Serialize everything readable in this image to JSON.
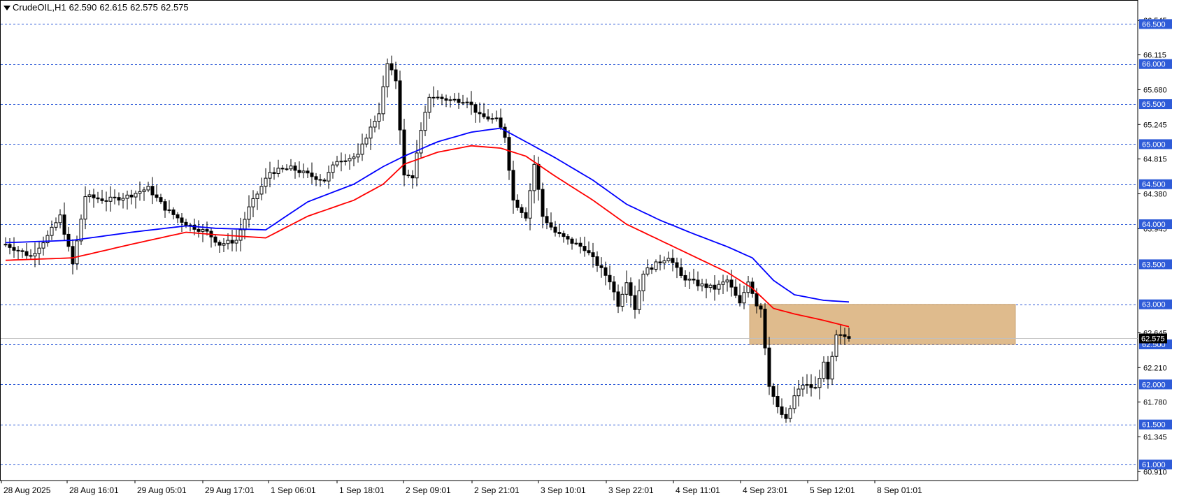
{
  "header": {
    "symbol": "CrudeOIL,H1",
    "open": "62.590",
    "high": "62.615",
    "low": "62.575",
    "close": "62.575"
  },
  "colors": {
    "bull_fill": "#ffffff",
    "bear_fill": "#000000",
    "candle_outline": "#000000",
    "ma_fast": "#ff0000",
    "ma_slow": "#0000ff",
    "level_line": "#2e5bd8",
    "level_label_bg": "#2e5bd8",
    "level_label_text": "#ffffff",
    "zone_fill": "#deb887",
    "price_label_bg": "#000000",
    "price_label_text": "#ffffff"
  },
  "chart_data": {
    "type": "candlestick",
    "timeframe": "H1",
    "ylim": [
      60.8,
      66.8
    ],
    "y_ticks": [
      "66.545",
      "66.115",
      "65.680",
      "65.245",
      "64.815",
      "64.380",
      "63.945",
      "62.645",
      "62.210",
      "61.780",
      "61.345",
      "60.910"
    ],
    "x_labels": [
      "28 Aug 2025",
      "28 Aug 16:01",
      "29 Aug 05:01",
      "29 Aug 17:01",
      "1 Sep 06:01",
      "1 Sep 18:01",
      "2 Sep 09:01",
      "2 Sep 21:01",
      "3 Sep 10:01",
      "3 Sep 22:01",
      "4 Sep 11:01",
      "4 Sep 23:01",
      "5 Sep 12:01",
      "8 Sep 01:01"
    ],
    "levels": [
      "66.500",
      "66.000",
      "65.500",
      "65.000",
      "64.500",
      "64.000",
      "63.500",
      "63.000",
      "62.500",
      "62.000",
      "61.500",
      "61.000"
    ],
    "current_price": "62.575",
    "zone": {
      "from": 62.5,
      "to": 63.0
    },
    "anchors": [
      [
        0,
        63.75
      ],
      [
        6,
        63.6
      ],
      [
        10,
        63.85
      ],
      [
        13,
        64.1
      ],
      [
        16,
        63.5
      ],
      [
        19,
        64.35
      ],
      [
        24,
        64.3
      ],
      [
        29,
        64.35
      ],
      [
        34,
        64.45
      ],
      [
        38,
        64.2
      ],
      [
        43,
        64.0
      ],
      [
        48,
        63.9
      ],
      [
        51,
        63.75
      ],
      [
        55,
        63.8
      ],
      [
        58,
        64.2
      ],
      [
        63,
        64.65
      ],
      [
        68,
        64.7
      ],
      [
        73,
        64.6
      ],
      [
        76,
        64.55
      ],
      [
        79,
        64.8
      ],
      [
        84,
        64.85
      ],
      [
        86,
        65.1
      ],
      [
        89,
        65.4
      ],
      [
        91,
        66.0
      ],
      [
        93,
        65.8
      ],
      [
        95,
        64.6
      ],
      [
        97,
        64.6
      ],
      [
        99,
        65.15
      ],
      [
        101,
        65.6
      ],
      [
        106,
        65.55
      ],
      [
        110,
        65.55
      ],
      [
        113,
        65.35
      ],
      [
        117,
        65.3
      ],
      [
        119,
        65.1
      ],
      [
        121,
        64.3
      ],
      [
        124,
        64.1
      ],
      [
        126,
        64.75
      ],
      [
        128,
        64.1
      ],
      [
        131,
        63.9
      ],
      [
        134,
        63.8
      ],
      [
        138,
        63.7
      ],
      [
        141,
        63.5
      ],
      [
        144,
        63.3
      ],
      [
        146,
        63.0
      ],
      [
        148,
        63.3
      ],
      [
        150,
        62.95
      ],
      [
        152,
        63.4
      ],
      [
        155,
        63.5
      ],
      [
        158,
        63.6
      ],
      [
        161,
        63.35
      ],
      [
        165,
        63.25
      ],
      [
        169,
        63.2
      ],
      [
        172,
        63.3
      ],
      [
        175,
        63.0
      ],
      [
        177,
        63.3
      ],
      [
        179,
        63.0
      ],
      [
        180,
        62.95
      ],
      [
        182,
        62.0
      ],
      [
        184,
        61.7
      ],
      [
        186,
        61.55
      ],
      [
        188,
        61.85
      ],
      [
        190,
        62.0
      ],
      [
        193,
        61.95
      ],
      [
        195,
        62.25
      ],
      [
        196,
        62.05
      ],
      [
        198,
        62.6
      ],
      [
        200,
        62.6
      ],
      [
        201,
        62.58
      ]
    ],
    "series": [
      {
        "name": "",
        "color": "#ff0000",
        "anchors": [
          [
            0,
            63.55
          ],
          [
            16,
            63.58
          ],
          [
            30,
            63.75
          ],
          [
            43,
            63.9
          ],
          [
            50,
            63.87
          ],
          [
            62,
            63.83
          ],
          [
            72,
            64.1
          ],
          [
            83,
            64.3
          ],
          [
            90,
            64.5
          ],
          [
            95,
            64.75
          ],
          [
            103,
            64.9
          ],
          [
            111,
            64.98
          ],
          [
            118,
            64.95
          ],
          [
            124,
            64.85
          ],
          [
            131,
            64.6
          ],
          [
            140,
            64.3
          ],
          [
            148,
            64.0
          ],
          [
            156,
            63.8
          ],
          [
            164,
            63.6
          ],
          [
            172,
            63.4
          ],
          [
            178,
            63.2
          ],
          [
            183,
            62.95
          ],
          [
            188,
            62.88
          ],
          [
            195,
            62.8
          ],
          [
            201,
            62.72
          ]
        ]
      },
      {
        "name": "",
        "color": "#0000ff",
        "anchors": [
          [
            0,
            63.77
          ],
          [
            16,
            63.8
          ],
          [
            30,
            63.9
          ],
          [
            43,
            63.98
          ],
          [
            50,
            63.95
          ],
          [
            62,
            63.93
          ],
          [
            72,
            64.28
          ],
          [
            83,
            64.5
          ],
          [
            90,
            64.72
          ],
          [
            95,
            64.85
          ],
          [
            103,
            65.03
          ],
          [
            111,
            65.15
          ],
          [
            118,
            65.2
          ],
          [
            124,
            65.03
          ],
          [
            131,
            64.83
          ],
          [
            140,
            64.55
          ],
          [
            148,
            64.25
          ],
          [
            156,
            64.05
          ],
          [
            164,
            63.88
          ],
          [
            172,
            63.72
          ],
          [
            178,
            63.58
          ],
          [
            183,
            63.3
          ],
          [
            188,
            63.12
          ],
          [
            195,
            63.05
          ],
          [
            201,
            63.03
          ]
        ]
      }
    ]
  }
}
